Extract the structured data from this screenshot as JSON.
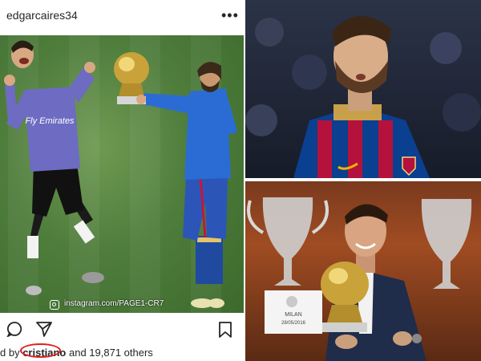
{
  "post": {
    "username": "edgarcaires34",
    "more_icon": "more-horizontal-icon",
    "watermark": "instagram.com/PAGE1-CR7",
    "jersey_text": "Fly Emirates",
    "likes_prefix": "d by ",
    "liked_by": "cristiano",
    "likes_suffix": " and 19,871 others",
    "icons": [
      "comment-icon",
      "share-icon",
      "bookmark-icon"
    ]
  },
  "photo_bottom": {
    "placard_city": "MILAN",
    "placard_date": "28/05/2016"
  },
  "colors": {
    "highlight": "#e02020",
    "text": "#262626",
    "barca_red": "#a50044",
    "barca_blue": "#004d98"
  }
}
